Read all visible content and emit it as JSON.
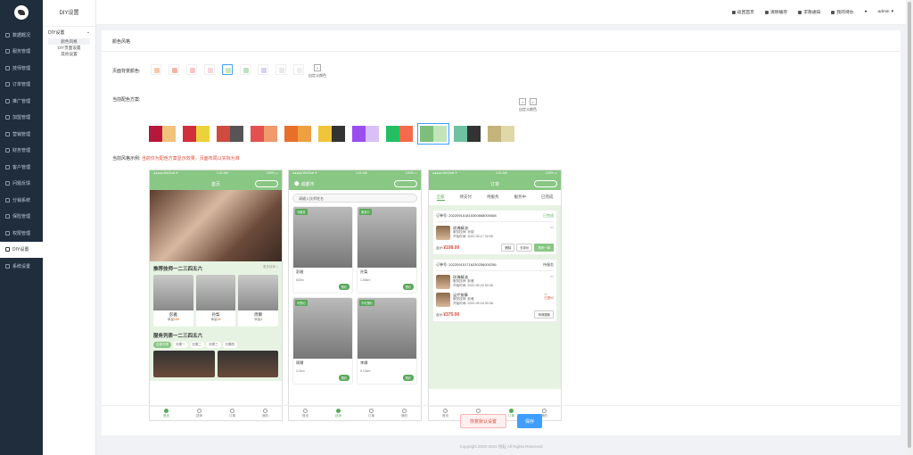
{
  "nav": {
    "items": [
      "数据概况",
      "服务管理",
      "技师管理",
      "订单管理",
      "推广管理",
      "加盟管理",
      "营销管理",
      "财务管理",
      "客户管理",
      "问题反馈",
      "分销系统",
      "保险管理",
      "权限管理",
      "DIY设置",
      "系统设置"
    ],
    "active": "DIY设置"
  },
  "subnav": {
    "title": "DIY设置",
    "group": "DIY设置",
    "leaves": [
      "颜色风格",
      "DIY页面设置",
      "其他设置"
    ]
  },
  "topbar": {
    "home": "返回首页",
    "cache": "清除缓存",
    "notice": "求救通知",
    "todo": "我的待办",
    "user": "admin"
  },
  "card": {
    "tab": "颜色风格",
    "bg_label": "页面背景颜色:",
    "palette_label": "当前配色方案:",
    "custom_label": "自定义颜色",
    "preview_label": "当前风格示例:",
    "preview_note": "当前仅为配色方案显示效果，页面布局以实际为准",
    "bg_colors": [
      "#f7c9a8",
      "#f2b7a8",
      "#f5c6c6",
      "#f7d6dc",
      "#c9e8b9",
      "#bfe0c0",
      "#d7d0f0",
      "#e8e8e8",
      "#eeeeee"
    ],
    "palettes": [
      [
        "#b5183a",
        "#f0c27a"
      ],
      [
        "#d0303a",
        "#ead23a"
      ],
      [
        "#cf4a3f",
        "#555555"
      ],
      [
        "#e3524e",
        "#f09a6c"
      ],
      [
        "#e86f2a",
        "#f0a040"
      ],
      [
        "#f0c53a",
        "#333333"
      ],
      [
        "#9a4ef0",
        "#d8c0f7"
      ],
      [
        "#23c063",
        "#f56a4a"
      ],
      [
        "#7dbf7a",
        "#c2e4b8"
      ],
      [
        "#6ec2a0",
        "#333333"
      ],
      [
        "#c2b47a",
        "#e0d8a8"
      ]
    ]
  },
  "phone1": {
    "status_left": "●●●●● WeChat ✈",
    "status_time": "1:21 AM",
    "status_right": "100% ▭",
    "title": "首页",
    "sec1": "推荐技师一二三四五六",
    "sec1_more": "更多技师 >",
    "techs": [
      {
        "name": "彭雅",
        "orders": "120"
      },
      {
        "name": "孙梨",
        "orders": "19"
      },
      {
        "name": "周爾",
        "orders": "2"
      }
    ],
    "orders_label": "单量",
    "sec2": "服务列表一二三四五六",
    "chips": [
      "全部分类",
      "分类一",
      "分类二",
      "分类三",
      "分类四"
    ],
    "tabs": [
      "首页",
      "技师",
      "订单",
      "我的"
    ]
  },
  "phone2": {
    "city": "成都市",
    "search": "请输入技师姓名",
    "cells": [
      {
        "tag": "可服务",
        "name": "彭雅",
        "dist": "600m"
      },
      {
        "tag": "服务中",
        "name": "孙梨",
        "dist": "1.86km"
      },
      {
        "tag": "可预约",
        "name": "周爾",
        "dist": "3.2km"
      },
      {
        "tag": "不可预约",
        "name": "李娜",
        "dist": "5.12km"
      }
    ],
    "book": "预约",
    "tabs": [
      "首页",
      "技师",
      "订单",
      "我的"
    ]
  },
  "phone3": {
    "title": "订单",
    "tabs": [
      "全部",
      "待支付",
      "待服务",
      "服务中",
      "已完成"
    ],
    "orders": [
      {
        "no": "订单号: 202209151815300868000068",
        "status": "已完成",
        "items": [
          {
            "name": "玫瑰精油",
            "tech": "服务技师: 孙梨",
            "time": "开始时间: 2022-09-17 02:08",
            "qty": "x1"
          }
        ],
        "total": "¥108.00",
        "btns": [
          "删除",
          "去评价",
          "再来一单"
        ]
      },
      {
        "no": "订单号: 202209151716230256000256",
        "status": "待服务",
        "items": [
          {
            "name": "玫瑰精油",
            "tech": "服务技师: 彭雅",
            "time": "开始时间: 2022-09-16 00:38",
            "qty": "x1"
          },
          {
            "name": "足疗按摩",
            "tech": "服务技师: 彭雅",
            "time": "开始时间: 2022-09-16 00:38",
            "qty": "x1",
            "extra": "已退x2"
          }
        ],
        "total": "¥375.90",
        "btns": [
          "申请退款"
        ]
      }
    ],
    "total_label": "合计:",
    "bottom_tabs": [
      "首页",
      "技师",
      "订单",
      "我的"
    ]
  },
  "actions": {
    "reset": "恢复默认设置",
    "save": "保存"
  },
  "copyright": "Copyright 2020-2024 悦耘 All Rights Reserved"
}
